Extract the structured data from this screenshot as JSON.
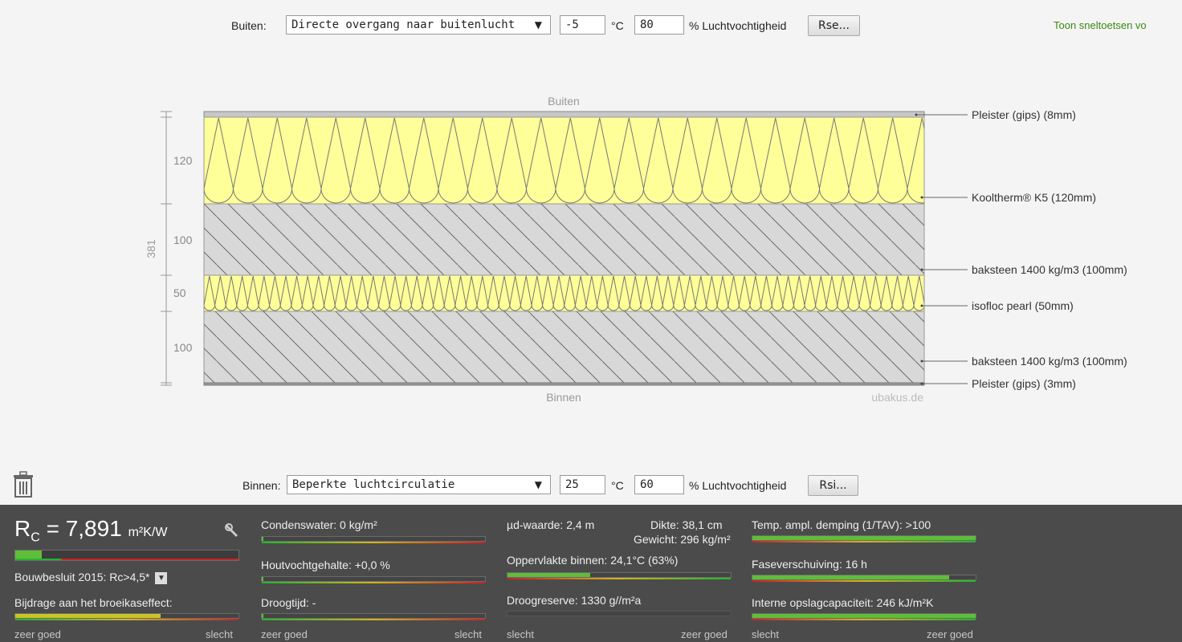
{
  "outside": {
    "label": "Buiten:",
    "condition": "Directe overgang naar buitenlucht",
    "temperature": "-5",
    "temp_unit": "°C",
    "humidity": "80",
    "humidity_label": "% Luchtvochtigheid",
    "resistance_button": "Rse..."
  },
  "shortcuts_link": "Toon sneltoetsen vo",
  "diagram": {
    "top_label": "Buiten",
    "bottom_label": "Binnen",
    "watermark": "ubakus.de",
    "total_thickness": "381",
    "dims": [
      "120",
      "100",
      "50",
      "100"
    ],
    "layers": [
      {
        "label": "Pleister (gips) (8mm)"
      },
      {
        "label": "Kooltherm® K5 (120mm)"
      },
      {
        "label": "baksteen 1400 kg/m3 (100mm)"
      },
      {
        "label": "isofloc pearl (50mm)"
      },
      {
        "label": "baksteen 1400 kg/m3 (100mm)"
      },
      {
        "label": "Pleister (gips) (3mm)"
      }
    ],
    "colors": {
      "insulation": "#ffff99",
      "brick": "#d8d8d8",
      "plaster": "#bdbdbd"
    }
  },
  "inside": {
    "label": "Binnen:",
    "condition": "Beperkte luchtcirculatie",
    "temperature": "25",
    "temp_unit": "°C",
    "humidity": "60",
    "humidity_label": "% Luchtvochtigheid",
    "resistance_button": "Rsi..."
  },
  "panel": {
    "rc_symbol": "R",
    "rc_sub": "C",
    "rc_value": "= 7,891",
    "rc_unit": "m²K/W",
    "rc_fill": 0.12,
    "bouwbesluit": "Bouwbesluit 2015: Rc>4,5*",
    "greenhouse": "Bijdrage aan het broeikaseffect:",
    "greenhouse_fill": 0.65,
    "condensation": "Condenswater: 0 kg/m²",
    "wood_moisture": "Houtvochtgehalte: +0,0 %",
    "drying_time": "Droogtijd: -",
    "ud_value": "µd-waarde: 2,4 m",
    "thickness": "Dikte: 38,1 cm",
    "weight": "Gewicht: 296 kg/m²",
    "surface_inside": "Oppervlakte binnen: 24,1°C (63%)",
    "surface_fill": 0.37,
    "drying_reserve": "Droogreserve: 1330 g//m²a",
    "temp_damping": "Temp. ampl. demping (1/TAV): >100",
    "temp_damping_fill": 1.0,
    "phase_shift": "Faseverschuiving: 16 h",
    "phase_shift_fill": 0.88,
    "storage": "Interne opslagcapaciteit: 246 kJ/m²K",
    "storage_fill": 1.0,
    "scale_good": "zeer goed",
    "scale_bad": "slecht"
  }
}
